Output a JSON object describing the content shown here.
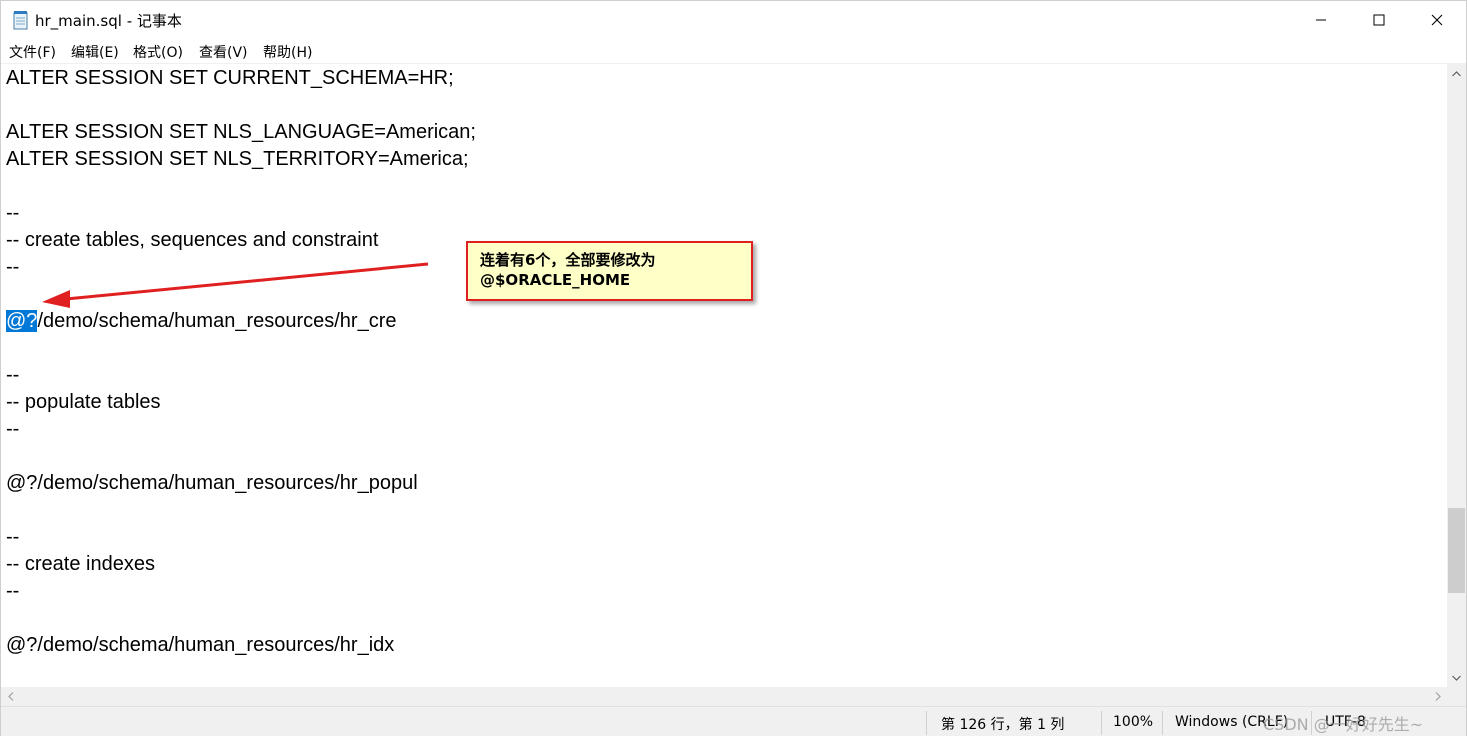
{
  "window": {
    "title": "hr_main.sql - 记事本"
  },
  "menu": {
    "items": [
      "文件(F)",
      "编辑(E)",
      "格式(O)",
      "查看(V)",
      "帮助(H)"
    ]
  },
  "editor": {
    "lines": [
      "ALTER SESSION SET CURRENT_SCHEMA=HR;",
      "",
      "ALTER SESSION SET NLS_LANGUAGE=American;",
      "ALTER SESSION SET NLS_TERRITORY=America;",
      "",
      "--",
      "-- create tables, sequences and constraint",
      "--",
      "",
      "/demo/schema/human_resources/hr_cre",
      "",
      "--",
      "-- populate tables",
      "--",
      "",
      "@?/demo/schema/human_resources/hr_popul",
      "",
      "--",
      "-- create indexes",
      "--",
      "",
      "@?/demo/schema/human_resources/hr_idx"
    ],
    "selected_text": "@?"
  },
  "callout": {
    "line1": "连着有6个，全部要修改为",
    "line2": "@$ORACLE_HOME"
  },
  "status": {
    "position": "第 126 行，第 1 列",
    "zoom": "100%",
    "line_ending": "Windows (CRLF)",
    "encoding": "UTF-8"
  },
  "watermark": "CSDN @一好好先生~",
  "colors": {
    "selection": "#0078d7",
    "callout_bg": "#ffffc8",
    "callout_border": "#e02020",
    "arrow": "#e02020"
  },
  "icons": [
    "notepad-icon",
    "minimize-icon",
    "maximize-icon",
    "close-icon",
    "scroll-up-icon",
    "scroll-down-icon",
    "scroll-left-icon",
    "scroll-right-icon"
  ]
}
